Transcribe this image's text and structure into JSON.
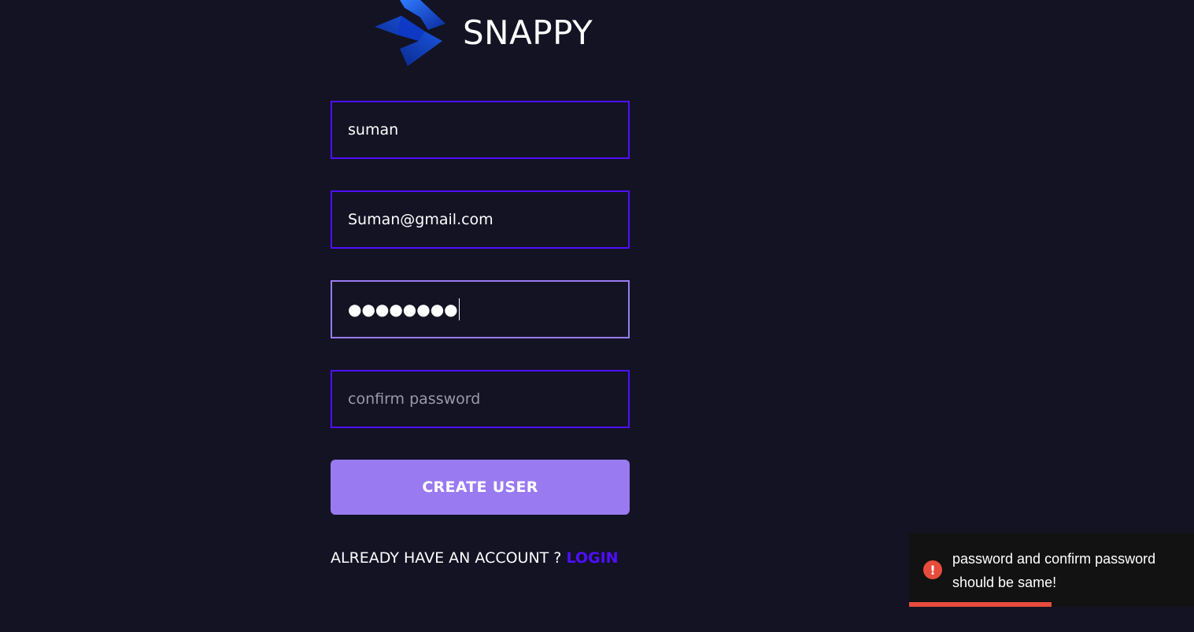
{
  "brand": {
    "name": "SNAPPY"
  },
  "form": {
    "username": {
      "value": "suman"
    },
    "email": {
      "value": "Suman@gmail.com"
    },
    "password": {
      "masked_value": "●●●●●●●●"
    },
    "confirm_password": {
      "placeholder": "confirm password",
      "value": ""
    },
    "submit_label": "CREATE USER",
    "switch_prompt": "ALREADY HAVE AN ACCOUNT ? ",
    "switch_link": "LOGIN"
  },
  "toast": {
    "type": "error",
    "icon": "exclamation-icon",
    "icon_glyph": "!",
    "message": "password and confirm password should be same!",
    "progress_fraction": 0.5
  },
  "colors": {
    "background": "#131324",
    "field_border": "#4e0eff",
    "field_border_focused": "#997af0",
    "button": "#997af0",
    "link": "#4e0eff",
    "toast_background": "#121212",
    "error": "#e74c3c"
  }
}
